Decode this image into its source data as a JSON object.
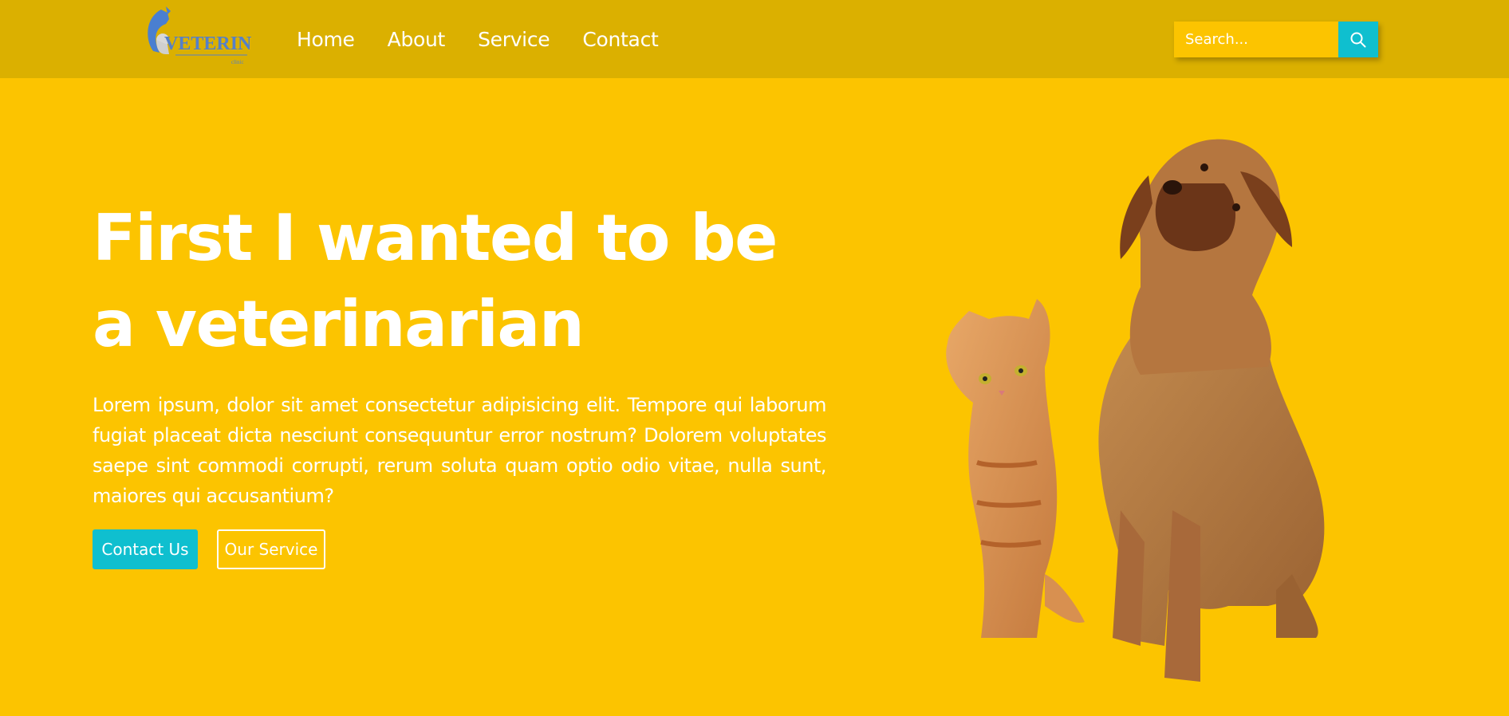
{
  "nav": {
    "logo_text": "VETERINARY",
    "links": [
      "Home",
      "About",
      "Service",
      "Contact"
    ],
    "search_placeholder": "Search...",
    "search_icon": "search-icon"
  },
  "hero": {
    "title_line1": "First I wanted to be",
    "title_line2": "a veterinarian",
    "body": "Lorem ipsum, dolor sit amet consectetur adipisicing elit. Tempore qui laborum fugiat placeat dicta nesciunt consequuntur error nostrum? Dolorem voluptates saepe sint commodi corrupti, rerum soluta quam optio odio vitae, nulla sunt, maiores qui accusantium?",
    "primary_button": "Contact Us",
    "secondary_button": "Our Service"
  },
  "colors": {
    "background": "#fcc400",
    "navbar": "#dbb000",
    "accent": "#0fbfcf",
    "text": "#ffffff"
  }
}
